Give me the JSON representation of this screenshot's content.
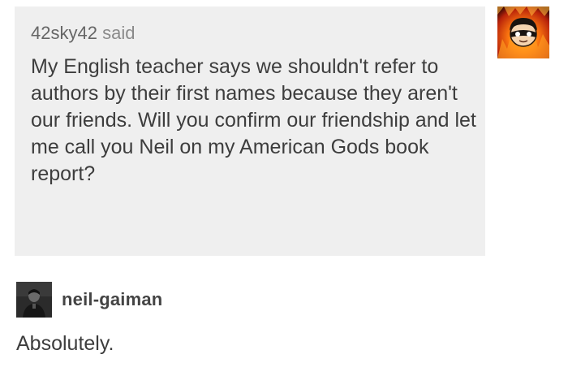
{
  "ask": {
    "asker_name": "42sky42",
    "said_label": "said",
    "body": "My English teacher says we shouldn't refer to authors by their first names because they aren't our friends. Will you confirm our friendship and let me call you Neil on my American Gods book report?",
    "asker_avatar_icon": "cartoon-avatar-fire-background"
  },
  "answer": {
    "answerer_name": "neil-gaiman",
    "answerer_avatar_icon": "dark-portrait-photo",
    "body": "Absolutely."
  },
  "colors": {
    "ask_background": "#efefef",
    "text": "#3d3d3d",
    "meta_text": "#777777"
  }
}
